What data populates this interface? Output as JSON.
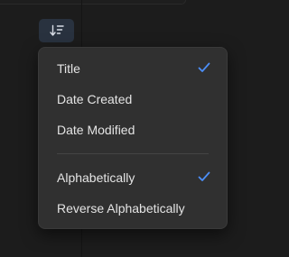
{
  "toolbar": {
    "sort_icon": "sort-descending-icon"
  },
  "sort_menu": {
    "sort_by": [
      {
        "label": "Title",
        "checked": true
      },
      {
        "label": "Date Created",
        "checked": false
      },
      {
        "label": "Date Modified",
        "checked": false
      }
    ],
    "order": [
      {
        "label": "Alphabetically",
        "checked": true
      },
      {
        "label": "Reverse Alphabetically",
        "checked": false
      }
    ]
  },
  "colors": {
    "accent": "#4c8ef7",
    "menu_bg": "#303030",
    "button_bg": "#29323f",
    "text": "#e4e4e4",
    "background": "#1c1c1c"
  }
}
